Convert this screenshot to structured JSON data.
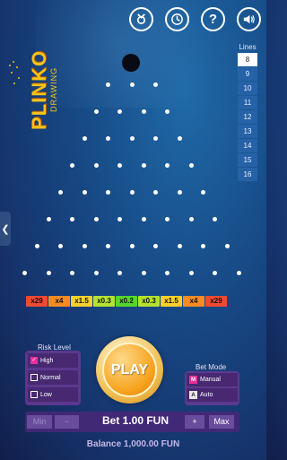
{
  "header": {
    "icons": [
      {
        "name": "trophy-icon",
        "label": ""
      },
      {
        "name": "history-icon",
        "label": ""
      },
      {
        "name": "help-icon",
        "label": "?"
      },
      {
        "name": "sound-icon",
        "label": ""
      }
    ]
  },
  "logo": {
    "main": "PLINKO",
    "sub": "DRAWING"
  },
  "lines": {
    "title": "Lines",
    "options": [
      "8",
      "9",
      "10",
      "11",
      "12",
      "13",
      "14",
      "15",
      "16"
    ],
    "selected": "8"
  },
  "side_tab": {
    "label": "❮"
  },
  "multipliers": [
    {
      "label": "x29",
      "color": "#ef4a2f"
    },
    {
      "label": "x4",
      "color": "#f58b22"
    },
    {
      "label": "x1.5",
      "color": "#f8d02d"
    },
    {
      "label": "x0.3",
      "color": "#b5e22f"
    },
    {
      "label": "x0.2",
      "color": "#55d82a"
    },
    {
      "label": "x0.3",
      "color": "#b5e22f"
    },
    {
      "label": "x1.5",
      "color": "#f8d02d"
    },
    {
      "label": "x4",
      "color": "#f58b22"
    },
    {
      "label": "x29",
      "color": "#ef4a2f"
    }
  ],
  "risk": {
    "title": "Risk Level",
    "options": [
      "High",
      "Normal",
      "Low"
    ],
    "selected": "High"
  },
  "play": {
    "label": "PLAY"
  },
  "bet_mode": {
    "title": "Bet Mode",
    "options": [
      {
        "key": "M",
        "label": "Manual"
      },
      {
        "key": "A",
        "label": "Auto"
      }
    ],
    "selected": "Manual"
  },
  "bet": {
    "min_label": "Min",
    "minus_label": "−",
    "amount": "Bet 1.00 FUN",
    "plus_label": "+",
    "max_label": "Max"
  },
  "balance": "Balance 1,000.00 FUN",
  "colors": {
    "accent": "#f6a31f",
    "panel": "#683a94",
    "highlight": "#e6309a"
  }
}
